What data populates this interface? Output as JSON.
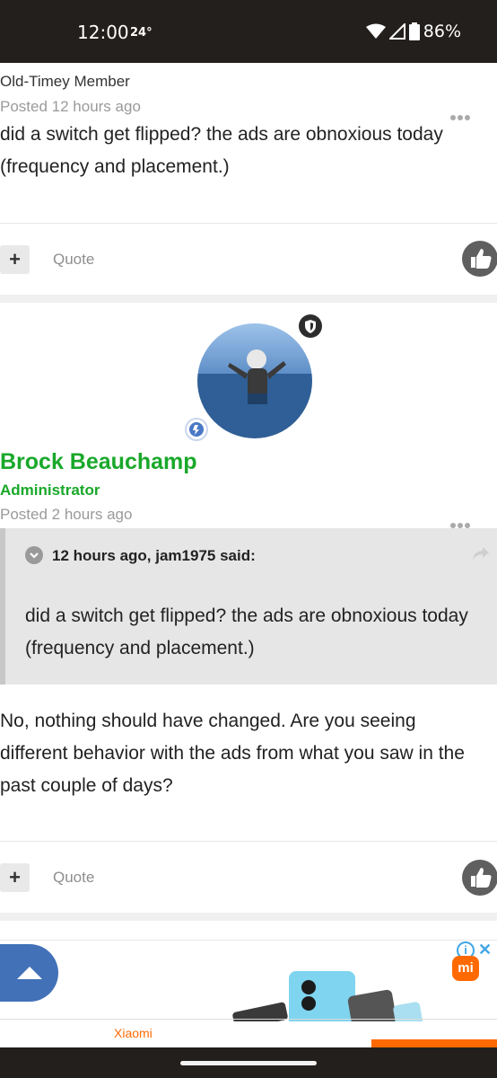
{
  "status_bar": {
    "time": "12:00",
    "temperature": "24°",
    "battery": "86%"
  },
  "post1": {
    "role": "Old-Timey Member",
    "posted": "Posted 12 hours ago",
    "body": "did a switch get flipped? the ads are obnoxious today (frequency and placement.)"
  },
  "actions": {
    "plus_label": "+",
    "quote_label": "Quote"
  },
  "post2": {
    "author": "Brock Beauchamp",
    "role": "Administrator",
    "posted": "Posted 2 hours ago",
    "quote": {
      "attribution": "12 hours ago, jam1975 said:",
      "text": "did a switch get flipped? the ads are obnoxious today (frequency and placement.)"
    },
    "body_lines": [
      "No, nothing should have changed. Are you seeing",
      "different behavior with the ads from what you saw in the",
      "past couple of days?"
    ]
  },
  "ad": {
    "info": "i",
    "close": "✕",
    "logo": "mi",
    "brand": "Xiaomi"
  },
  "colors": {
    "status_bar": "#231f1c",
    "admin_green": "#19a82a",
    "scroll_button": "#4271b8",
    "ad_orange": "#ff6900"
  }
}
